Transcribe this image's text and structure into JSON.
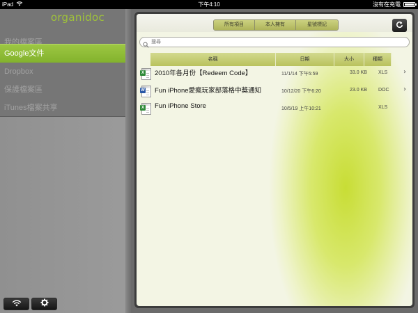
{
  "status_bar": {
    "device": "iPad",
    "time": "下午4:10",
    "charging": "沒有在充電"
  },
  "sidebar": {
    "logo": "organidoc",
    "items": [
      {
        "label": "我的檔案區",
        "active": false
      },
      {
        "label": "Google文件",
        "active": true
      },
      {
        "label": "Dropbox",
        "active": false
      },
      {
        "label": "保護檔案區",
        "active": false
      },
      {
        "label": "iTunes檔案共享",
        "active": false
      }
    ],
    "bottom_buttons": [
      "wifi-icon",
      "gear-icon"
    ]
  },
  "toolbar": {
    "segments": [
      "所有項目",
      "本人擁有",
      "星號標記"
    ],
    "refresh_icon": "refresh-icon"
  },
  "search": {
    "placeholder": "搜尋"
  },
  "table": {
    "columns": [
      "名稱",
      "日期",
      "大小",
      "種類"
    ],
    "rows": [
      {
        "icon": "xls-file-icon",
        "name": "2010年各月份【Redeem Code】",
        "date": "11/1/14 下午5:59",
        "size": "33.0 KB",
        "type": "XLS",
        "has_chevron": true
      },
      {
        "icon": "doc-file-icon",
        "name": "Fun iPhone愛瘋玩家部落格中獎通知",
        "date": "10/12/20 下午6:20",
        "size": "23.0 KB",
        "type": "DOC",
        "has_chevron": true
      },
      {
        "icon": "xls-file-icon",
        "name": "Fun iPhone Store",
        "date": "10/5/19 上午10:21",
        "size": "",
        "type": "XLS",
        "has_chevron": false
      }
    ]
  },
  "colors": {
    "accent_green": "#8fbc36",
    "logo_green": "#9fc23a",
    "header_olive": "#c4cc74"
  }
}
